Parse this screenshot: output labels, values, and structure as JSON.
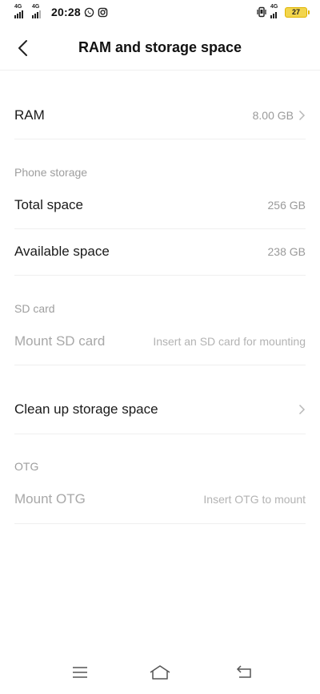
{
  "status_bar": {
    "sim1": "4G",
    "sim2": "4G",
    "time": "20:28",
    "right_net": "4G",
    "battery": "27",
    "icons": [
      "whatsapp-icon",
      "instagram-icon",
      "vibrate-icon"
    ]
  },
  "header": {
    "title": "RAM and storage space"
  },
  "ram": {
    "label": "RAM",
    "value": "8.00 GB"
  },
  "phone_storage": {
    "heading": "Phone storage",
    "total_label": "Total space",
    "total_value": "256 GB",
    "available_label": "Available space",
    "available_value": "238 GB"
  },
  "sd_card": {
    "heading": "SD card",
    "mount_label": "Mount SD card",
    "mount_hint": "Insert an SD card for mounting"
  },
  "cleanup": {
    "label": "Clean up storage space"
  },
  "otg": {
    "heading": "OTG",
    "mount_label": "Mount OTG",
    "mount_hint": "Insert OTG to mount"
  },
  "nav": {
    "icons": [
      "menu-icon",
      "home-icon",
      "back-nav-icon"
    ]
  }
}
